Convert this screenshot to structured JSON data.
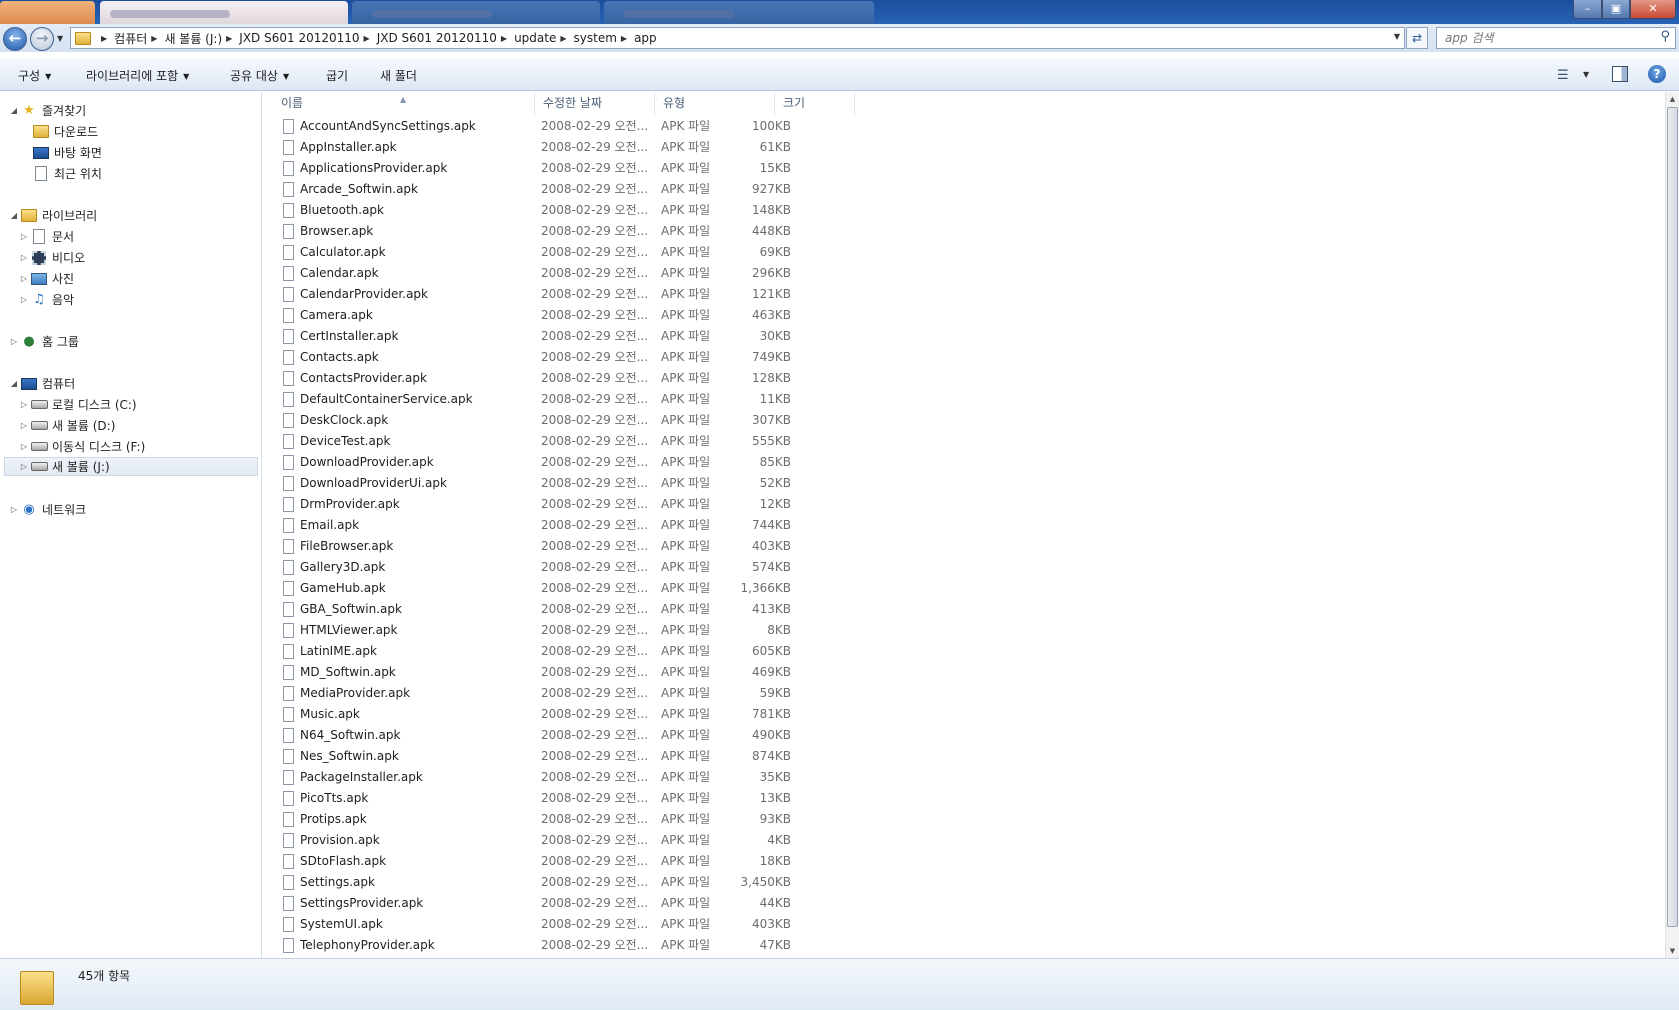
{
  "address": {
    "crumbs": [
      "컴퓨터",
      "새 볼륨 (J:)",
      "JXD S601 20120110",
      "JXD S601 20120110",
      "update",
      "system",
      "app"
    ],
    "search_placeholder": "app 검색"
  },
  "toolbar": {
    "organize": "구성",
    "include_library": "라이브러리에 포함",
    "share_with": "공유 대상",
    "burn": "굽기",
    "new_folder": "새 폴더"
  },
  "nav": {
    "favorites": "즐겨찾기",
    "downloads": "다운로드",
    "desktop": "바탕 화면",
    "recent": "최근 위치",
    "libraries": "라이브러리",
    "documents": "문서",
    "videos": "비디오",
    "pictures": "사진",
    "music": "음악",
    "homegroup": "홈 그룹",
    "computer": "컴퓨터",
    "local_c": "로컬 디스크 (C:)",
    "volume_d": "새 볼륨 (D:)",
    "removable_f": "이동식 디스크 (F:)",
    "volume_j": "새 볼륨 (J:)",
    "network": "네트워크"
  },
  "columns": {
    "name": "이름",
    "modified": "수정한 날짜",
    "type": "유형",
    "size": "크기"
  },
  "files": [
    {
      "name": "AccountAndSyncSettings.apk",
      "date": "2008-02-29 오전...",
      "type": "APK 파일",
      "size": "100KB"
    },
    {
      "name": "AppInstaller.apk",
      "date": "2008-02-29 오전...",
      "type": "APK 파일",
      "size": "61KB"
    },
    {
      "name": "ApplicationsProvider.apk",
      "date": "2008-02-29 오전...",
      "type": "APK 파일",
      "size": "15KB"
    },
    {
      "name": "Arcade_Softwin.apk",
      "date": "2008-02-29 오전...",
      "type": "APK 파일",
      "size": "927KB"
    },
    {
      "name": "Bluetooth.apk",
      "date": "2008-02-29 오전...",
      "type": "APK 파일",
      "size": "148KB"
    },
    {
      "name": "Browser.apk",
      "date": "2008-02-29 오전...",
      "type": "APK 파일",
      "size": "448KB"
    },
    {
      "name": "Calculator.apk",
      "date": "2008-02-29 오전...",
      "type": "APK 파일",
      "size": "69KB"
    },
    {
      "name": "Calendar.apk",
      "date": "2008-02-29 오전...",
      "type": "APK 파일",
      "size": "296KB"
    },
    {
      "name": "CalendarProvider.apk",
      "date": "2008-02-29 오전...",
      "type": "APK 파일",
      "size": "121KB"
    },
    {
      "name": "Camera.apk",
      "date": "2008-02-29 오전...",
      "type": "APK 파일",
      "size": "463KB"
    },
    {
      "name": "CertInstaller.apk",
      "date": "2008-02-29 오전...",
      "type": "APK 파일",
      "size": "30KB"
    },
    {
      "name": "Contacts.apk",
      "date": "2008-02-29 오전...",
      "type": "APK 파일",
      "size": "749KB"
    },
    {
      "name": "ContactsProvider.apk",
      "date": "2008-02-29 오전...",
      "type": "APK 파일",
      "size": "128KB"
    },
    {
      "name": "DefaultContainerService.apk",
      "date": "2008-02-29 오전...",
      "type": "APK 파일",
      "size": "11KB"
    },
    {
      "name": "DeskClock.apk",
      "date": "2008-02-29 오전...",
      "type": "APK 파일",
      "size": "307KB"
    },
    {
      "name": "DeviceTest.apk",
      "date": "2008-02-29 오전...",
      "type": "APK 파일",
      "size": "555KB"
    },
    {
      "name": "DownloadProvider.apk",
      "date": "2008-02-29 오전...",
      "type": "APK 파일",
      "size": "85KB"
    },
    {
      "name": "DownloadProviderUi.apk",
      "date": "2008-02-29 오전...",
      "type": "APK 파일",
      "size": "52KB"
    },
    {
      "name": "DrmProvider.apk",
      "date": "2008-02-29 오전...",
      "type": "APK 파일",
      "size": "12KB"
    },
    {
      "name": "Email.apk",
      "date": "2008-02-29 오전...",
      "type": "APK 파일",
      "size": "744KB"
    },
    {
      "name": "FileBrowser.apk",
      "date": "2008-02-29 오전...",
      "type": "APK 파일",
      "size": "403KB"
    },
    {
      "name": "Gallery3D.apk",
      "date": "2008-02-29 오전...",
      "type": "APK 파일",
      "size": "574KB"
    },
    {
      "name": "GameHub.apk",
      "date": "2008-02-29 오전...",
      "type": "APK 파일",
      "size": "1,366KB"
    },
    {
      "name": "GBA_Softwin.apk",
      "date": "2008-02-29 오전...",
      "type": "APK 파일",
      "size": "413KB"
    },
    {
      "name": "HTMLViewer.apk",
      "date": "2008-02-29 오전...",
      "type": "APK 파일",
      "size": "8KB"
    },
    {
      "name": "LatinIME.apk",
      "date": "2008-02-29 오전...",
      "type": "APK 파일",
      "size": "605KB"
    },
    {
      "name": "MD_Softwin.apk",
      "date": "2008-02-29 오전...",
      "type": "APK 파일",
      "size": "469KB"
    },
    {
      "name": "MediaProvider.apk",
      "date": "2008-02-29 오전...",
      "type": "APK 파일",
      "size": "59KB"
    },
    {
      "name": "Music.apk",
      "date": "2008-02-29 오전...",
      "type": "APK 파일",
      "size": "781KB"
    },
    {
      "name": "N64_Softwin.apk",
      "date": "2008-02-29 오전...",
      "type": "APK 파일",
      "size": "490KB"
    },
    {
      "name": "Nes_Softwin.apk",
      "date": "2008-02-29 오전...",
      "type": "APK 파일",
      "size": "874KB"
    },
    {
      "name": "PackageInstaller.apk",
      "date": "2008-02-29 오전...",
      "type": "APK 파일",
      "size": "35KB"
    },
    {
      "name": "PicoTts.apk",
      "date": "2008-02-29 오전...",
      "type": "APK 파일",
      "size": "13KB"
    },
    {
      "name": "Protips.apk",
      "date": "2008-02-29 오전...",
      "type": "APK 파일",
      "size": "93KB"
    },
    {
      "name": "Provision.apk",
      "date": "2008-02-29 오전...",
      "type": "APK 파일",
      "size": "4KB"
    },
    {
      "name": "SDtoFlash.apk",
      "date": "2008-02-29 오전...",
      "type": "APK 파일",
      "size": "18KB"
    },
    {
      "name": "Settings.apk",
      "date": "2008-02-29 오전...",
      "type": "APK 파일",
      "size": "3,450KB"
    },
    {
      "name": "SettingsProvider.apk",
      "date": "2008-02-29 오전...",
      "type": "APK 파일",
      "size": "44KB"
    },
    {
      "name": "SystemUI.apk",
      "date": "2008-02-29 오전...",
      "type": "APK 파일",
      "size": "403KB"
    },
    {
      "name": "TelephonyProvider.apk",
      "date": "2008-02-29 오전...",
      "type": "APK 파일",
      "size": "47KB"
    }
  ],
  "status": {
    "item_count": "45개 항목"
  },
  "icons": {
    "back": "back-arrow-icon",
    "forward": "forward-arrow-icon",
    "refresh": "refresh-icon",
    "search": "search-icon",
    "view": "view-options-icon",
    "preview_pane": "preview-pane-icon",
    "help": "help-icon",
    "file": "file-icon",
    "folder": "folder-icon"
  },
  "colors": {
    "titlebar": "#2a66b8",
    "address_bg": "#dfe8f4",
    "toolbar_bg": "#e8eff8",
    "selected_bg": "#e3eaf2"
  }
}
